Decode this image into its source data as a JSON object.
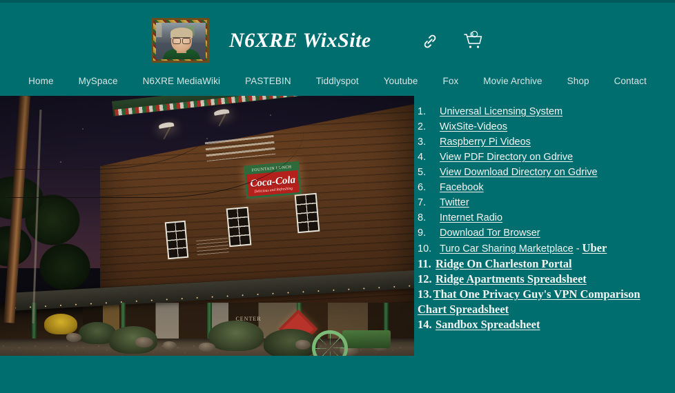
{
  "theme": {
    "background": "#006d6e",
    "top_strip": "#00595a",
    "text": "#f2f6f3",
    "nav_text": "#d8e6e4"
  },
  "header": {
    "site_title": "N6XRE WixSite",
    "avatar_alt": "portrait-photo",
    "link_icon": "chain-link-icon",
    "cart_icon": "shopping-cart-icon",
    "cart_count": "0"
  },
  "nav": {
    "items": [
      {
        "label": "Home"
      },
      {
        "label": "MySpace"
      },
      {
        "label": "N6XRE MediaWiki"
      },
      {
        "label": "PASTEBIN"
      },
      {
        "label": "Tiddlyspot"
      },
      {
        "label": "Youtube"
      },
      {
        "label": "Fox"
      },
      {
        "label": "Movie Archive"
      },
      {
        "label": "Shop"
      },
      {
        "label": "Contact"
      }
    ]
  },
  "photo": {
    "caption": "night photo of an old wooden general store with Coca-Cola Fountain Lunch sign",
    "signs": {
      "coke_top": "FOUNTAIN LUNCH",
      "coke_mid": "Coca-Cola",
      "coke_bottom": "Delicious and Refreshing",
      "center_sign": "CENTER"
    }
  },
  "links": {
    "items": [
      {
        "num": "1.",
        "label": "Universal Licensing System",
        "style": "sans"
      },
      {
        "num": "2.",
        "label": "WixSite-Videos",
        "style": "sans"
      },
      {
        "num": "3.",
        "label": "Raspberry Pi Videos",
        "style": "sans"
      },
      {
        "num": "4.",
        "label": "View PDF Directory on Gdrive",
        "style": "sans"
      },
      {
        "num": "5.",
        "label": "View Download Directory on Gdrive",
        "style": "sans"
      },
      {
        "num": "6.",
        "label": "Facebook",
        "style": "sans"
      },
      {
        "num": "7.",
        "label": "Twitter",
        "style": "sans"
      },
      {
        "num": "8.",
        "label": "Internet Radio",
        "style": "sans"
      },
      {
        "num": "9.",
        "label": "Download Tor Browser",
        "style": "sans"
      },
      {
        "num": "10.",
        "label": "Turo Car Sharing Marketplace",
        "style": "sans",
        "separator": "-",
        "label2": "Uber"
      },
      {
        "num": "11.",
        "label": "Ridge On Charleston Portal",
        "style": "serif"
      },
      {
        "num": "12.",
        "label": "Ridge Apartments Spreadsheet",
        "style": "serif"
      },
      {
        "num": "13.",
        "label": "That One Privacy Guy's VPN Comparison Chart Spreadsheet",
        "style": "serif"
      },
      {
        "num": "14.",
        "label": "Sandbox Spreadsheet",
        "style": "serif"
      }
    ]
  }
}
